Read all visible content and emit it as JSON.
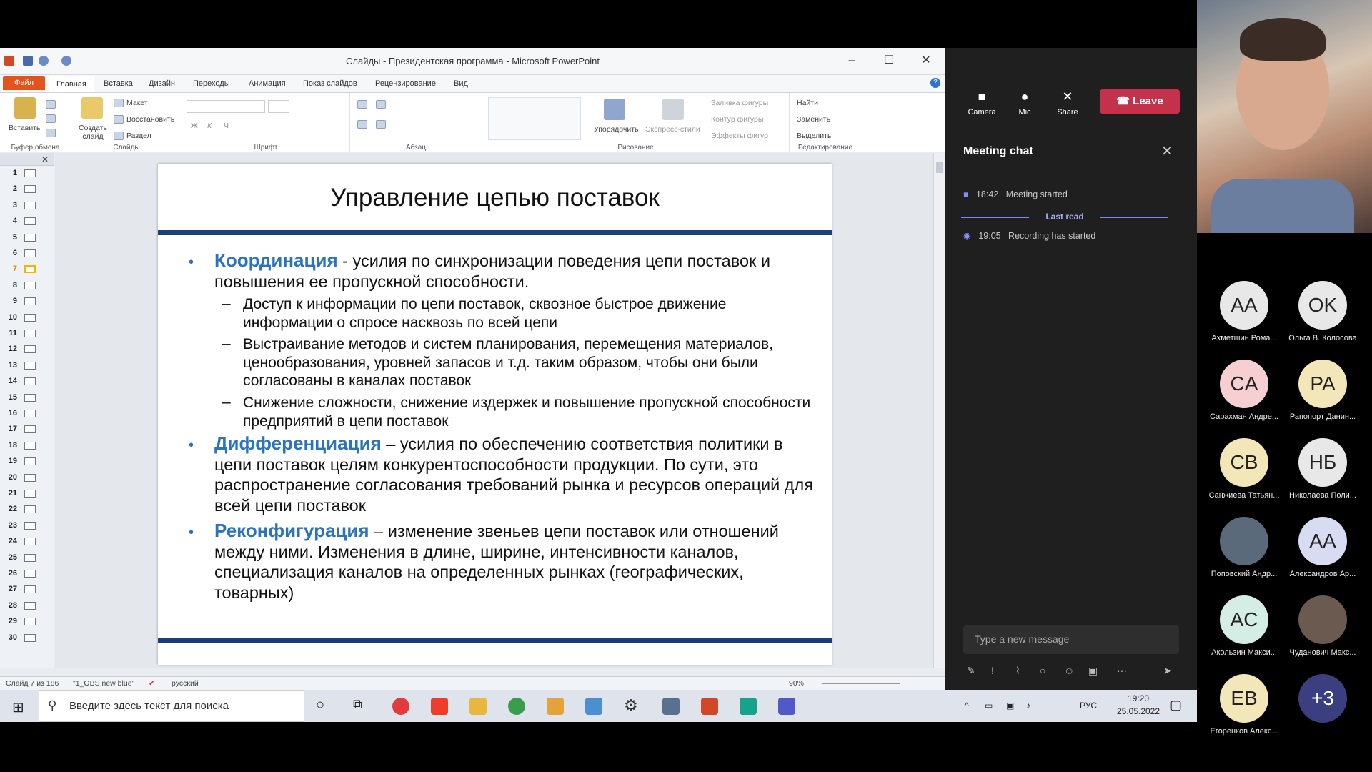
{
  "powerpoint": {
    "title": "Слайды - Президентская программа - Microsoft PowerPoint",
    "tabs": [
      "Файл",
      "Главная",
      "Вставка",
      "Дизайн",
      "Переходы",
      "Анимация",
      "Показ слайдов",
      "Рецензирование",
      "Вид"
    ],
    "ribbon": {
      "clipboard": {
        "paste": "Вставить",
        "group": "Буфер обмена"
      },
      "slides": {
        "new": "Создать слайд",
        "layout": "Макет",
        "reset": "Восстановить",
        "section": "Раздел",
        "group": "Слайды"
      },
      "font_group": "Шрифт",
      "paragraph_group": "Абзац",
      "drawing": {
        "arrange": "Упорядочить",
        "quick_styles": "Экспресс-стили",
        "fill": "Заливка фигуры",
        "outline": "Контур фигуры",
        "effects": "Эффекты фигур",
        "group": "Рисование"
      },
      "editing": {
        "find": "Найти",
        "replace": "Заменить",
        "select": "Выделить",
        "group": "Редактирование"
      }
    },
    "slide_numbers": [
      "1",
      "2",
      "3",
      "4",
      "5",
      "6",
      "7",
      "8",
      "9",
      "10",
      "11",
      "12",
      "13",
      "14",
      "15",
      "16",
      "17",
      "18",
      "19",
      "20",
      "21",
      "22",
      "23",
      "24",
      "25",
      "26",
      "27",
      "28",
      "29",
      "30"
    ],
    "slide": {
      "title": "Управление цепью поставок",
      "p1_kw": "Координация",
      "p1_text": " - усилия по синхронизации поведения цепи поставок и повышения ее пропускной способности.",
      "s1": "Доступ к информации по цепи поставок, сквозное быстрое движение информации о спросе насквозь по всей цепи",
      "s2": "Выстраивание методов и систем планирования, перемещения материалов, ценообразования, уровней запасов и т.д. таким образом, чтобы они были согласованы в каналах поставок",
      "s3": "Снижение сложности, снижение издержек и повышение пропускной способности предприятий в цепи поставок",
      "p2_kw": "Дифференциация",
      "p2_text": " – усилия по обеспечению соответствия политики в цепи поставок целям конкурентоспособности продукции. По сути, это распространение согласования требований рынка и ресурсов операций для всей цепи поставок",
      "p3_kw": "Реконфигурация",
      "p3_text": " – изменение звеньев цепи поставок или отношений между ними. Изменения в длине, ширине, интенсивности каналов, специализация каналов на определенных рынках (географических, товарных)"
    },
    "status": {
      "slide": "Слайд 7 из 186",
      "theme": "\"1_OBS new blue\"",
      "language": "русский",
      "zoom": "90%"
    }
  },
  "teams": {
    "controls": {
      "camera": "Camera",
      "mic": "Mic",
      "share": "Share",
      "leave": "Leave"
    },
    "chat_title": "Meeting chat",
    "events": [
      {
        "time": "18:42",
        "text": "Meeting started"
      },
      {
        "time": "19:05",
        "text": "Recording has started"
      }
    ],
    "last_read": "Last read",
    "message_placeholder": "Type a new message",
    "participants": [
      {
        "initials": "AA",
        "name": "Ахметшин Рома...",
        "color": "#e8e8e8"
      },
      {
        "initials": "OK",
        "name": "Ольга В. Колосова",
        "color": "#e8e8e8"
      },
      {
        "initials": "CA",
        "name": "Сарахман Андре...",
        "color": "#f6cfd2"
      },
      {
        "initials": "PA",
        "name": "Рапопорт Данин...",
        "color": "#f3e6b8"
      },
      {
        "initials": "CB",
        "name": "Санжиева Татьян...",
        "color": "#f3e6b8"
      },
      {
        "initials": "НБ",
        "name": "Николаева Поли...",
        "color": "#e8e8e8"
      },
      {
        "initials": "",
        "name": "Поповский Андр...",
        "color": "#5a6a7a"
      },
      {
        "initials": "AA",
        "name": "Александров Ар...",
        "color": "#d7dcf3"
      },
      {
        "initials": "AC",
        "name": "Акользин Макси...",
        "color": "#d5eee5"
      },
      {
        "initials": "",
        "name": "Чуданович Макс...",
        "color": "#6a5a50"
      },
      {
        "initials": "EB",
        "name": "Егоренков Алекс...",
        "color": "#f3e6b8"
      },
      {
        "initials": "+3",
        "name": "",
        "color": "#3b3f80"
      }
    ]
  },
  "taskbar": {
    "search_placeholder": "Введите здесь текст для поиска",
    "lang": "РУС",
    "time": "19:20",
    "date": "25.05.2022"
  }
}
